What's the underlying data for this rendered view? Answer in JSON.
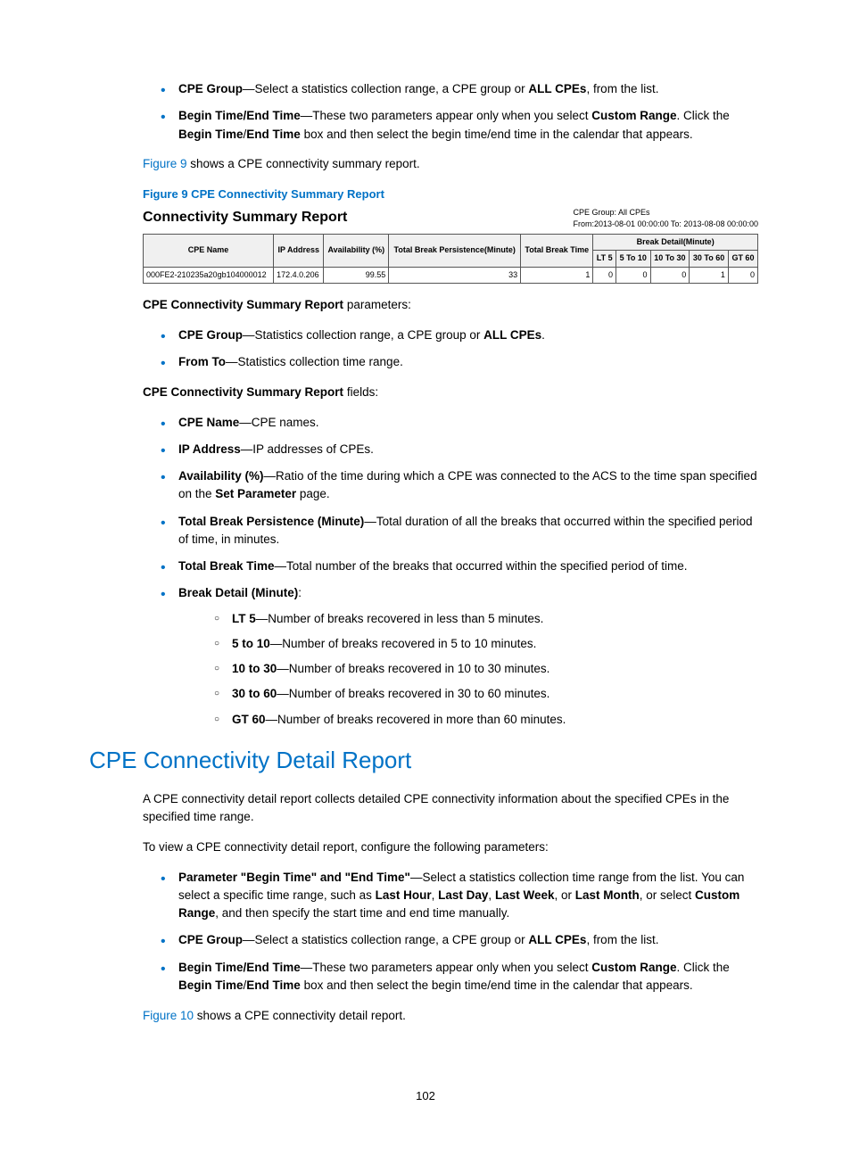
{
  "top_bullets": [
    {
      "bold1": "CPE Group",
      "text1": "—Select a statistics collection range, a CPE group or ",
      "bold2": "ALL CPEs",
      "text2": ", from the list."
    },
    {
      "bold1": "Begin Time/End Time",
      "text1": "—These two parameters appear only when you select ",
      "bold2": "Custom Range",
      "text2": ". Click the ",
      "bold3": "Begin Time",
      "text3": "/",
      "bold4": "End Time",
      "text4": " box and then select the begin time/end time in the calendar that appears."
    }
  ],
  "fig9_sentence": {
    "link": "Figure 9",
    "rest": " shows a CPE connectivity summary report."
  },
  "fig9_caption": "Figure 9 CPE Connectivity Summary Report",
  "report": {
    "title": "Connectivity Summary Report",
    "meta_group": "CPE Group: All CPEs",
    "meta_range": "From:2013-08-01 00:00:00  To:    2013-08-08 00:00:00",
    "headers": {
      "cpe_name": "CPE Name",
      "ip": "IP Address",
      "avail": "Availability (%)",
      "tbp": "Total Break Persistence(Minute)",
      "tbt": "Total Break Time",
      "bd": "Break Detail(Minute)",
      "lt5": "LT 5",
      "r5_10": "5 To 10",
      "r10_30": "10 To 30",
      "r30_60": "30 To 60",
      "gt60": "GT 60"
    },
    "row": {
      "cpe_name": "000FE2-210235a20gb104000012",
      "ip": "172.4.0.206",
      "avail": "99.55",
      "tbp": "33",
      "tbt": "1",
      "lt5": "0",
      "r5_10": "0",
      "r10_30": "0",
      "r30_60": "1",
      "gt60": "0"
    }
  },
  "params_heading": {
    "bold": "CPE Connectivity Summary Report",
    "rest": " parameters:"
  },
  "params_bullets": [
    {
      "bold1": "CPE Group",
      "text1": "—Statistics collection range, a CPE group or ",
      "bold2": "ALL CPEs",
      "text2": "."
    },
    {
      "bold1": "From To",
      "text1": "—Statistics collection time range."
    }
  ],
  "fields_heading": {
    "bold": "CPE Connectivity Summary Report",
    "rest": " fields:"
  },
  "fields_bullets": [
    {
      "bold1": "CPE Name",
      "text1": "—CPE names."
    },
    {
      "bold1": "IP Address",
      "text1": "—IP addresses of CPEs."
    },
    {
      "bold1": "Availability (%)",
      "text1": "—Ratio of the time during which a CPE was connected to the ACS to the time span specified on the ",
      "bold2": "Set Parameter",
      "text2": " page."
    },
    {
      "bold1": "Total Break Persistence (Minute)",
      "text1": "—Total duration of all the breaks that occurred within the specified period of time, in minutes."
    },
    {
      "bold1": "Total Break Time",
      "text1": "—Total number of the breaks that occurred within the specified period of time."
    },
    {
      "bold1": "Break Detail (Minute)",
      "text1": ":"
    }
  ],
  "break_sub": [
    {
      "bold": "LT 5",
      "rest": "—Number of breaks recovered in less than 5 minutes."
    },
    {
      "bold": "5 to 10",
      "rest": "—Number of breaks recovered in 5 to 10 minutes."
    },
    {
      "bold": "10 to 30",
      "rest": "—Number of breaks recovered in 10 to 30 minutes."
    },
    {
      "bold": "30 to 60",
      "rest": "—Number of breaks recovered in 30 to 60 minutes."
    },
    {
      "bold": "GT 60",
      "rest": "—Number of breaks recovered in more than 60 minutes."
    }
  ],
  "h2": "CPE Connectivity Detail Report",
  "detail_p1": "A CPE connectivity detail report collects detailed CPE connectivity information about the specified CPEs in the specified time range.",
  "detail_p2": "To view a CPE connectivity detail report, configure the following parameters:",
  "detail_bullets": [
    {
      "bold1": "Parameter \"Begin Time\" and \"End Time\"",
      "text1": "—Select a statistics collection time range from the list. You can select a specific time range, such as ",
      "bold2": "Last Hour",
      "text2": ", ",
      "bold3": "Last Day",
      "text3": ", ",
      "bold4": "Last Week",
      "text4": ", or ",
      "bold5": "Last Month",
      "text5": ", or select ",
      "bold6": "Custom Range",
      "text6": ", and then specify the start time and end time manually."
    },
    {
      "bold1": "CPE Group",
      "text1": "—Select a statistics collection range, a CPE group or ",
      "bold2": "ALL CPEs",
      "text2": ", from the list."
    },
    {
      "bold1": "Begin Time/End Time",
      "text1": "—These two parameters appear only when you select ",
      "bold2": "Custom Range",
      "text2": ". Click the ",
      "bold3": "Begin Time",
      "text3": "/",
      "bold4": "End Time",
      "text4": " box and then select the begin time/end time in the calendar that appears."
    }
  ],
  "fig10_sentence": {
    "link": "Figure 10",
    "rest": " shows a CPE connectivity detail report."
  },
  "page_number": "102"
}
